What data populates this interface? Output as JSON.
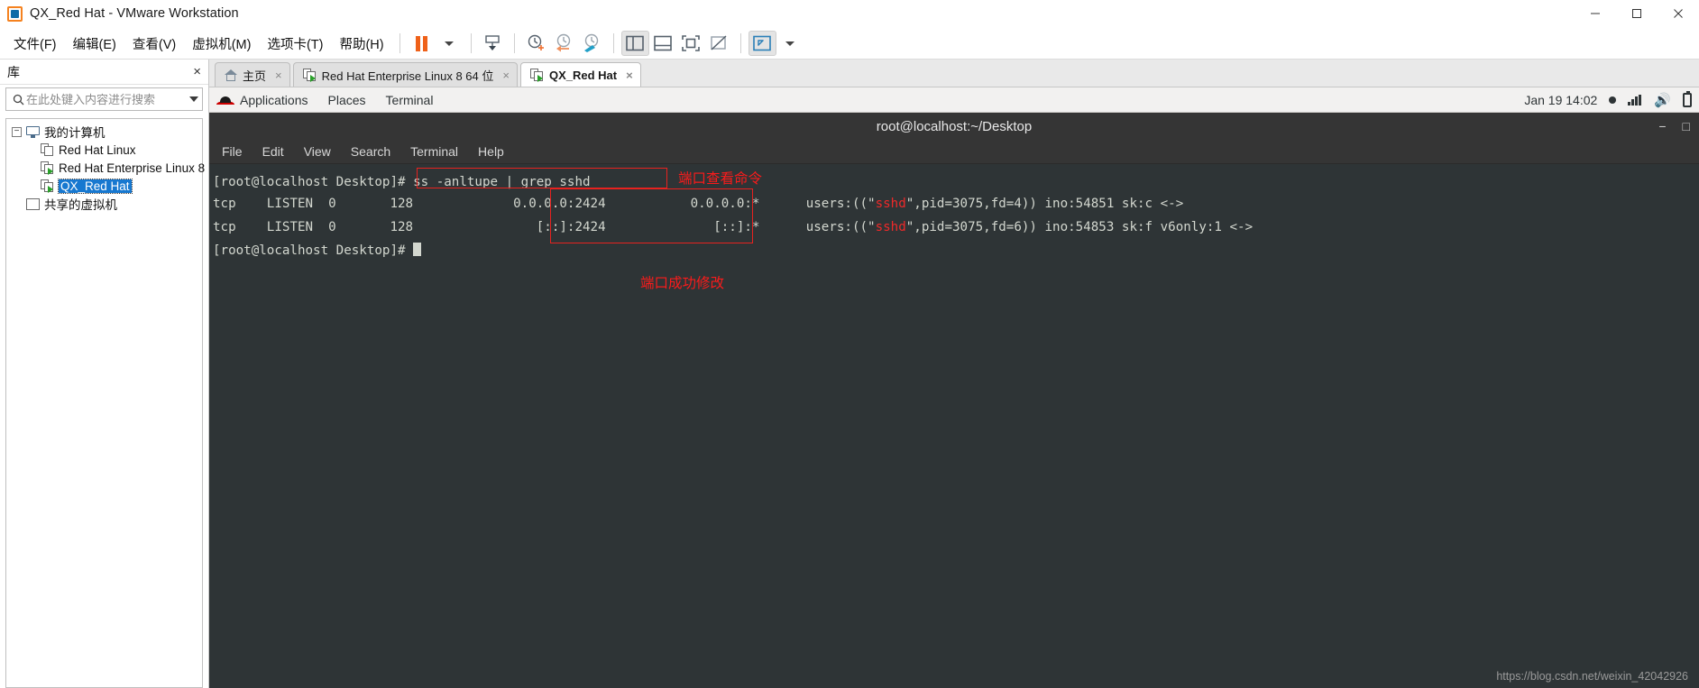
{
  "window": {
    "title": "QX_Red Hat - VMware Workstation",
    "app_icon": "vmware-logo-icon",
    "controls": {
      "minimize": "minimize-icon",
      "maximize": "maximize-icon",
      "close": "close-icon"
    }
  },
  "menubar": {
    "items": [
      {
        "label": "文件(F)",
        "name": "menu-file"
      },
      {
        "label": "编辑(E)",
        "name": "menu-edit"
      },
      {
        "label": "查看(V)",
        "name": "menu-view"
      },
      {
        "label": "虚拟机(M)",
        "name": "menu-vm"
      },
      {
        "label": "选项卡(T)",
        "name": "menu-tabs"
      },
      {
        "label": "帮助(H)",
        "name": "menu-help"
      }
    ],
    "toolbar": [
      {
        "name": "pause-button",
        "icon": "pause-icon"
      },
      {
        "name": "pause-dropdown",
        "icon": "chevron-down-icon"
      },
      {
        "name": "send-ctrl-alt-del-button",
        "icon": "keyboard-send-icon"
      },
      {
        "name": "snapshot-take-button",
        "icon": "clock-plus-icon"
      },
      {
        "name": "snapshot-revert-button",
        "icon": "clock-back-icon"
      },
      {
        "name": "snapshot-manager-button",
        "icon": "clock-wrench-icon"
      },
      {
        "name": "show-library-button",
        "icon": "panel-left-icon"
      },
      {
        "name": "show-thumbnail-bar-button",
        "icon": "panel-bottom-icon"
      },
      {
        "name": "fullscreen-button",
        "icon": "fullscreen-icon"
      },
      {
        "name": "unity-mode-button",
        "icon": "unity-icon"
      },
      {
        "name": "fit-guest-button",
        "icon": "expand-arrows-icon"
      },
      {
        "name": "fit-dropdown",
        "icon": "chevron-down-icon"
      }
    ]
  },
  "library": {
    "header_title": "库",
    "close_label": "×",
    "search": {
      "placeholder": "在此处键入内容进行搜索",
      "value": "",
      "icon": "search-icon"
    },
    "tree": [
      {
        "label": "我的计算机",
        "icon": "monitor-icon",
        "level": 0,
        "expander": "−",
        "selected": false
      },
      {
        "label": "Red Hat Linux",
        "icon": "vm-icon",
        "level": 1,
        "selected": false
      },
      {
        "label": "Red Hat Enterprise Linux 8",
        "icon": "vm-running-icon",
        "level": 1,
        "selected": false
      },
      {
        "label": "QX_Red Hat",
        "icon": "vm-running-icon",
        "level": 1,
        "selected": true
      },
      {
        "label": "共享的虚拟机",
        "icon": "folder-icon",
        "level": 0,
        "selected": false
      }
    ]
  },
  "tabs": [
    {
      "label": "主页",
      "icon": "home-icon",
      "active": false,
      "close": "×"
    },
    {
      "label": "Red Hat Enterprise Linux 8 64 位",
      "icon": "vm-running-icon",
      "active": false,
      "close": "×"
    },
    {
      "label": "QX_Red Hat",
      "icon": "vm-running-icon",
      "active": true,
      "close": "×"
    }
  ],
  "gnome": {
    "logo": "redhat-icon",
    "menus": [
      "Applications",
      "Places",
      "Terminal"
    ],
    "clock": "Jan 19  14:02",
    "indicators": [
      "record-dot-icon",
      "network-icon",
      "volume-icon",
      "power-icon"
    ]
  },
  "terminal": {
    "title": "root@localhost:~/Desktop",
    "window_buttons": {
      "minimize": "−",
      "maximize": "□"
    },
    "menus": [
      "File",
      "Edit",
      "View",
      "Search",
      "Terminal",
      "Help"
    ],
    "lines": [
      {
        "id": "prompt1",
        "segments": [
          {
            "text": "[root@localhost Desktop]# ",
            "color": "normal"
          },
          {
            "text": "ss -anltupe | grep sshd",
            "color": "normal"
          }
        ]
      },
      {
        "id": "out1",
        "segments": [
          {
            "text": "tcp    LISTEN  0       128             0.0.0.0:2424           0.0.0.0:*      users:((\"",
            "color": "normal"
          },
          {
            "text": "sshd",
            "color": "red"
          },
          {
            "text": "\",pid=3075,fd=4)) ino:54851 sk:c <->",
            "color": "normal"
          }
        ]
      },
      {
        "id": "out2",
        "segments": [
          {
            "text": "tcp    LISTEN  0       128                [::]:2424              [::]:*      users:((\"",
            "color": "normal"
          },
          {
            "text": "sshd",
            "color": "red"
          },
          {
            "text": "\",pid=3075,fd=6)) ino:54853 sk:f v6only:1 <->",
            "color": "normal"
          }
        ]
      },
      {
        "id": "prompt2",
        "segments": [
          {
            "text": "[root@localhost Desktop]# ",
            "color": "normal"
          }
        ],
        "cursor": true
      }
    ],
    "annotations": [
      {
        "name": "annotation-command-note",
        "text": "端口查看命令",
        "color": "#fa1b1b"
      },
      {
        "name": "annotation-port-changed-note",
        "text": "端口成功修改",
        "color": "#fa1b1b"
      }
    ],
    "highlight_color": "#e8221f"
  },
  "watermark": "https://blog.csdn.net/weixin_42042926"
}
